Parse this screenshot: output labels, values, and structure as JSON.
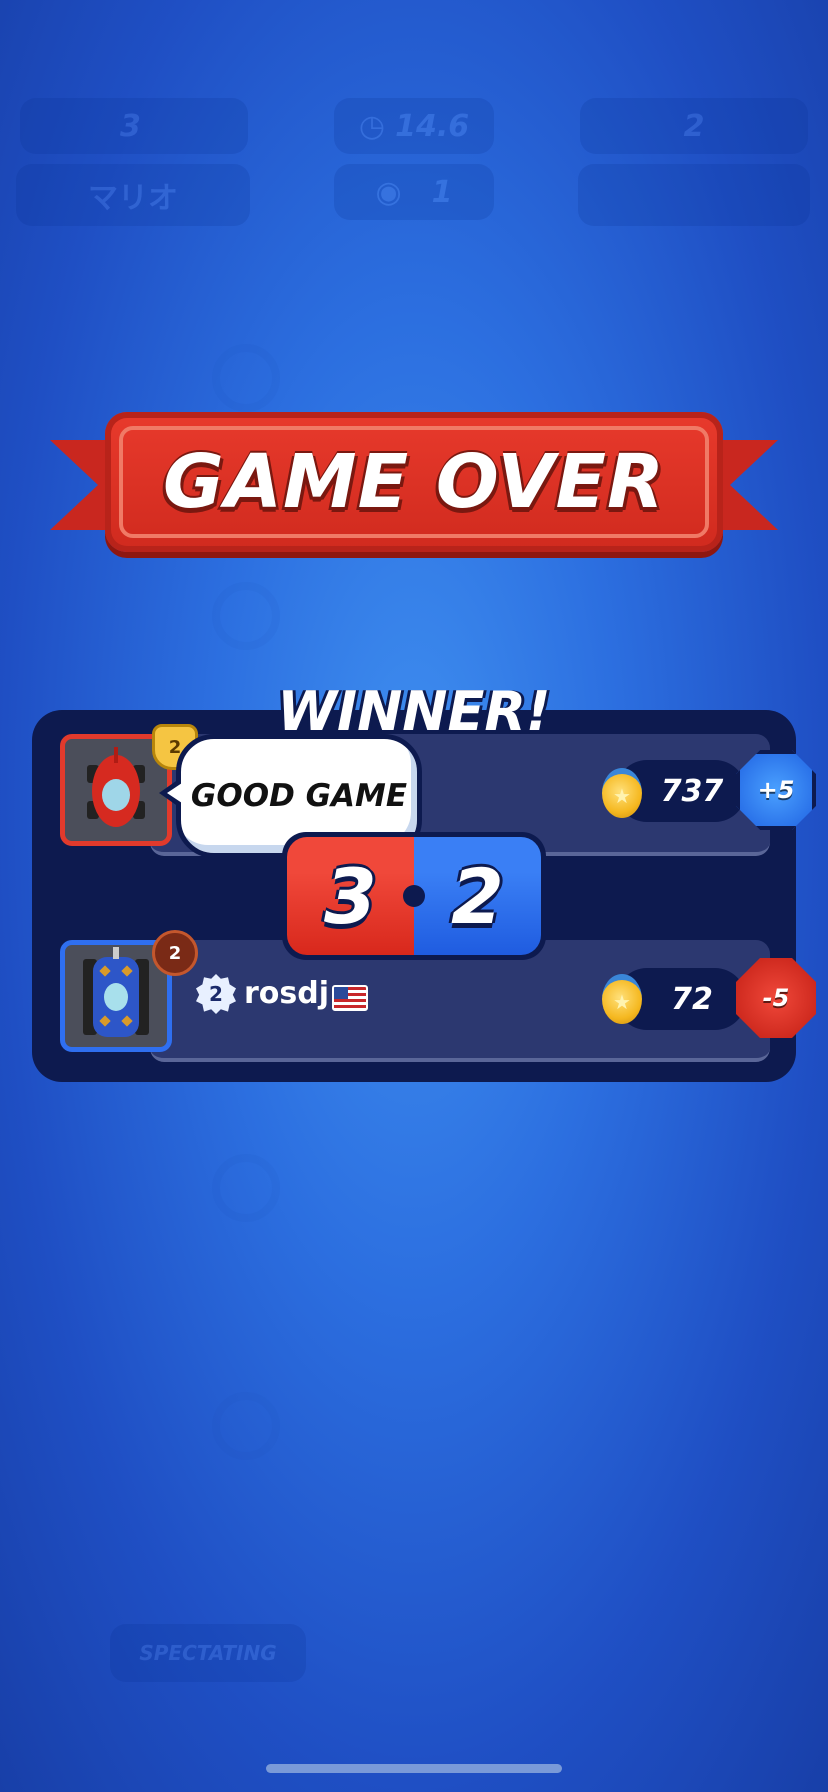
{
  "background_hud": {
    "left_score": "3",
    "left_name": "マリオ",
    "timer": "14.6",
    "spectators": "1",
    "right_score": "2",
    "spectating_label": "SPECTATING"
  },
  "banner": {
    "title": "GAME OVER"
  },
  "result": {
    "winner_label": "WINNER!",
    "chat_bubble": "GOOD GAME",
    "score_red": "3",
    "score_blue": "2",
    "players": [
      {
        "rank": "2",
        "trophies": "737",
        "delta": "+5"
      },
      {
        "rank": "2",
        "level": "2",
        "name": "rosdj",
        "trophies": "72",
        "delta": "-5"
      }
    ]
  },
  "colors": {
    "red": "#e13a2c",
    "blue": "#2f6ff0",
    "panel": "#0d1a4f"
  },
  "icons": [
    "eye-icon",
    "timer-icon",
    "trophy-icon",
    "us-flag-icon",
    "car-icon",
    "tank-icon"
  ]
}
